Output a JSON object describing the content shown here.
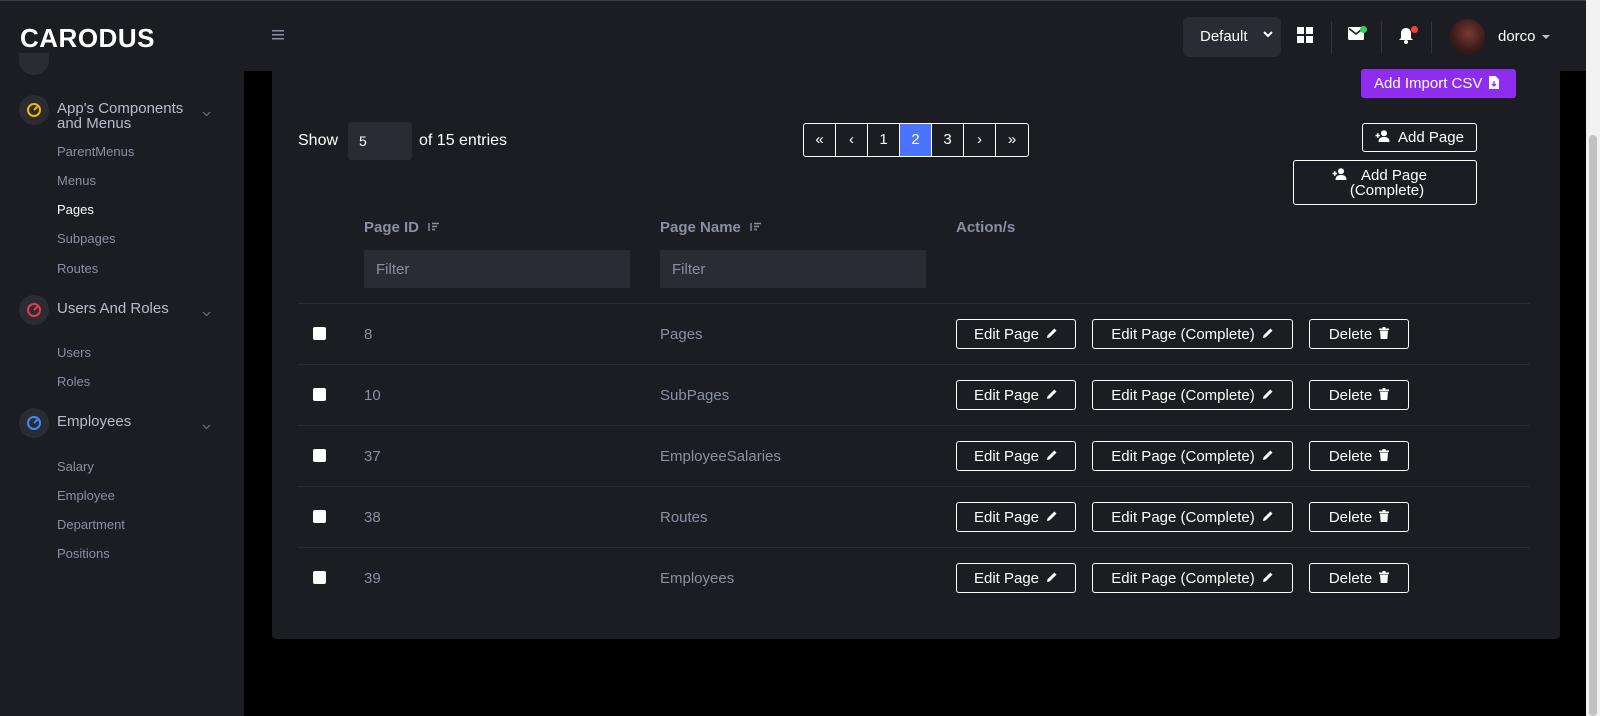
{
  "brand": "CARODUS",
  "header": {
    "theme_select": "Default",
    "username": "dorco"
  },
  "sidebar": {
    "sections": [
      {
        "label": "App's Components and Menus",
        "icon": "gauge-icon",
        "color": "#f5b301",
        "items": [
          "ParentMenus",
          "Menus",
          "Pages",
          "Subpages",
          "Routes"
        ]
      },
      {
        "label": "Users And Roles",
        "icon": "gauge-icon",
        "color": "#e63950",
        "items": [
          "Users",
          "Roles"
        ]
      },
      {
        "label": "Employees",
        "icon": "gauge-icon",
        "color": "#3d8bf2",
        "items": [
          "Salary",
          "Employee",
          "Department",
          "Positions"
        ]
      }
    ],
    "active_item": "Pages"
  },
  "toolbar": {
    "show_label": "Show",
    "page_size": "5",
    "entries_label": "of 15 entries",
    "add_csv": "Add Import CSV",
    "add_page": "Add Page",
    "add_page_complete": "Add Page (Complete)"
  },
  "pagination": {
    "first": "«",
    "prev": "‹",
    "pages": [
      "1",
      "2",
      "3"
    ],
    "current": "2",
    "next": "›",
    "last": "»"
  },
  "table": {
    "columns": [
      "Page ID",
      "Page Name",
      "Action/s"
    ],
    "filter_placeholder": "Filter",
    "rows": [
      {
        "id": "8",
        "name": "Pages"
      },
      {
        "id": "10",
        "name": "SubPages"
      },
      {
        "id": "37",
        "name": "EmployeeSalaries"
      },
      {
        "id": "38",
        "name": "Routes"
      },
      {
        "id": "39",
        "name": "Employees"
      }
    ],
    "actions": {
      "edit": "Edit Page",
      "edit_complete": "Edit Page (Complete)",
      "delete": "Delete"
    }
  },
  "colors": {
    "accent": "#4b73ff",
    "csv_button": "#8e2df0",
    "background": "#1c1d22"
  }
}
